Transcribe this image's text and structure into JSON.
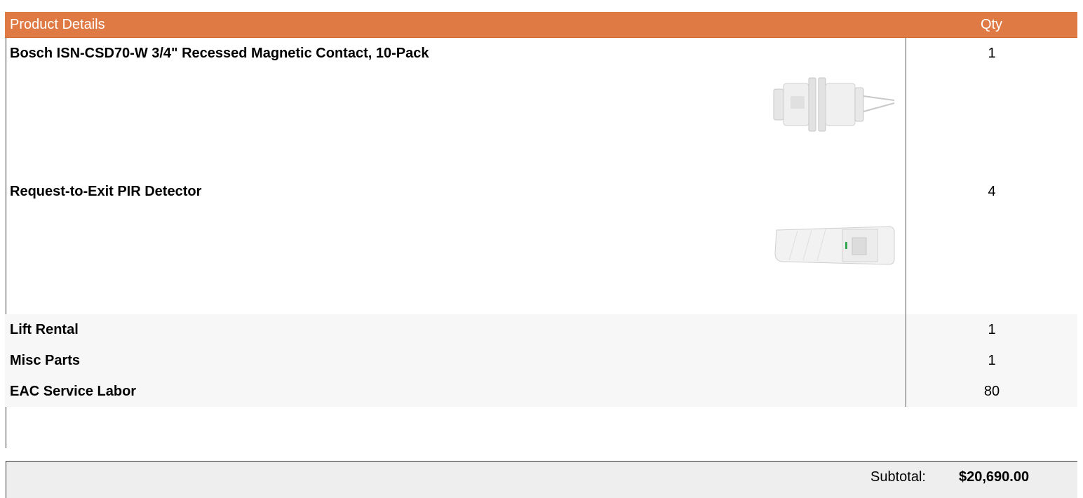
{
  "header": {
    "product_label": "Product Details",
    "qty_label": "Qty"
  },
  "rows": [
    {
      "name": "Bosch ISN-CSD70-W 3/4\" Recessed Magnetic Contact, 10-Pack",
      "qty": "1",
      "image": "recessed-magnetic-contact"
    },
    {
      "name": "Request-to-Exit PIR Detector",
      "qty": "4",
      "image": "pir-detector"
    },
    {
      "name": "Lift Rental",
      "qty": "1"
    },
    {
      "name": "Misc Parts",
      "qty": "1"
    },
    {
      "name": "EAC Service Labor",
      "qty": "80"
    }
  ],
  "subtotal": {
    "label": "Subtotal:",
    "value": "$20,690.00"
  },
  "colors": {
    "header_bg": "#e07a45",
    "header_text": "#ffffff",
    "alt_row_bg": "#f7f7f7",
    "subtotal_bg": "#eeeeee"
  }
}
